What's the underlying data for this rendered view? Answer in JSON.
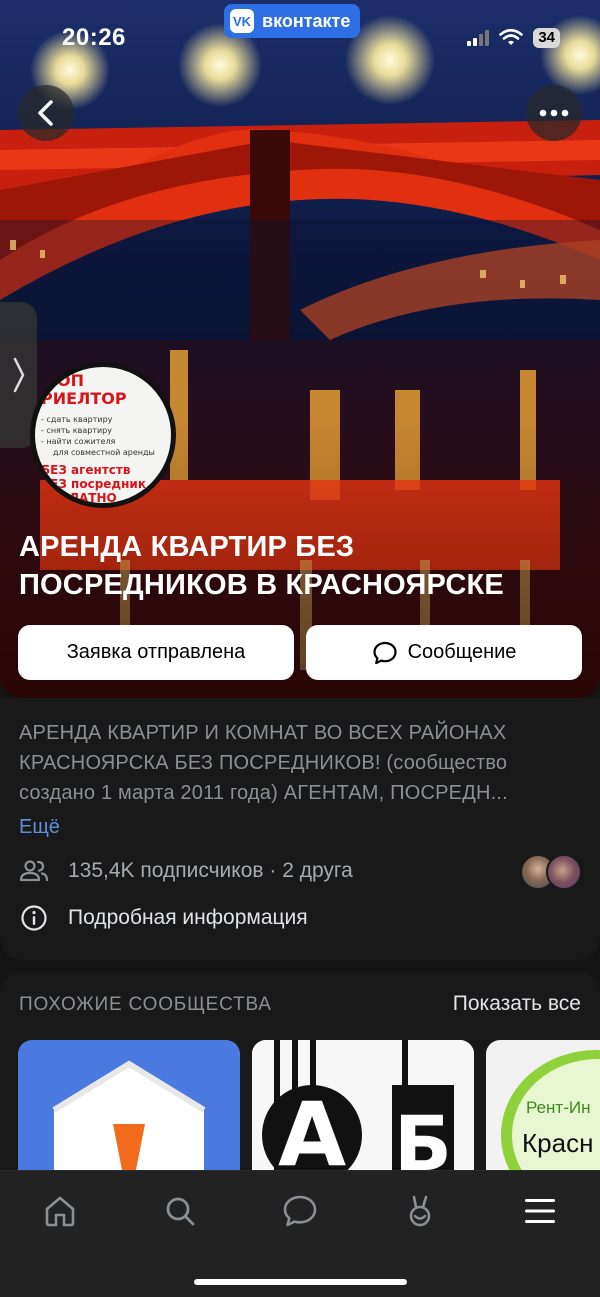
{
  "status_bar": {
    "time": "20:26",
    "app_badge": "вконтакте",
    "battery": "34"
  },
  "community": {
    "name": "АРЕНДА КВАРТИР БЕЗ ПОСРЕДНИКОВ В КРАСНОЯРСКЕ",
    "avatar_lines": [
      "ОП",
      "РИЕЛТОР",
      "- сдать квартиру",
      "- снять квартиру",
      "- найти сожителя",
      "для совместной аренды",
      "БЕЗ агентств",
      "БЕЗ посредник",
      "ПЛАТНО"
    ]
  },
  "actions": {
    "request_label": "Заявка отправлена",
    "message_label": "Сообщение"
  },
  "info": {
    "description": "АРЕНДА КВАРТИР И КОМНАТ ВО ВСЕХ РАЙОНАХ КРАСНОЯРСКА БЕЗ ПОСРЕДНИКОВ!  (сообщество создано 1 марта 2011 года) АГЕНТАМ, ПОСРЕДН...",
    "more_label": "Ещё",
    "subscribers": "135,4K подписчиков · 2 друга",
    "details_label": "Подробная информация"
  },
  "similar": {
    "heading": "ПОХОЖИЕ СООБЩЕСТВА",
    "show_all": "Показать все",
    "card3_line1": "Рент-Ин",
    "card3_line2": "Красн"
  },
  "tabs": [
    "home-icon",
    "search-icon",
    "messages-icon",
    "clips-icon",
    "menu-icon"
  ],
  "colors": {
    "accent": "#2f6fe6",
    "link": "#5d8fd8",
    "background": "#141414"
  }
}
